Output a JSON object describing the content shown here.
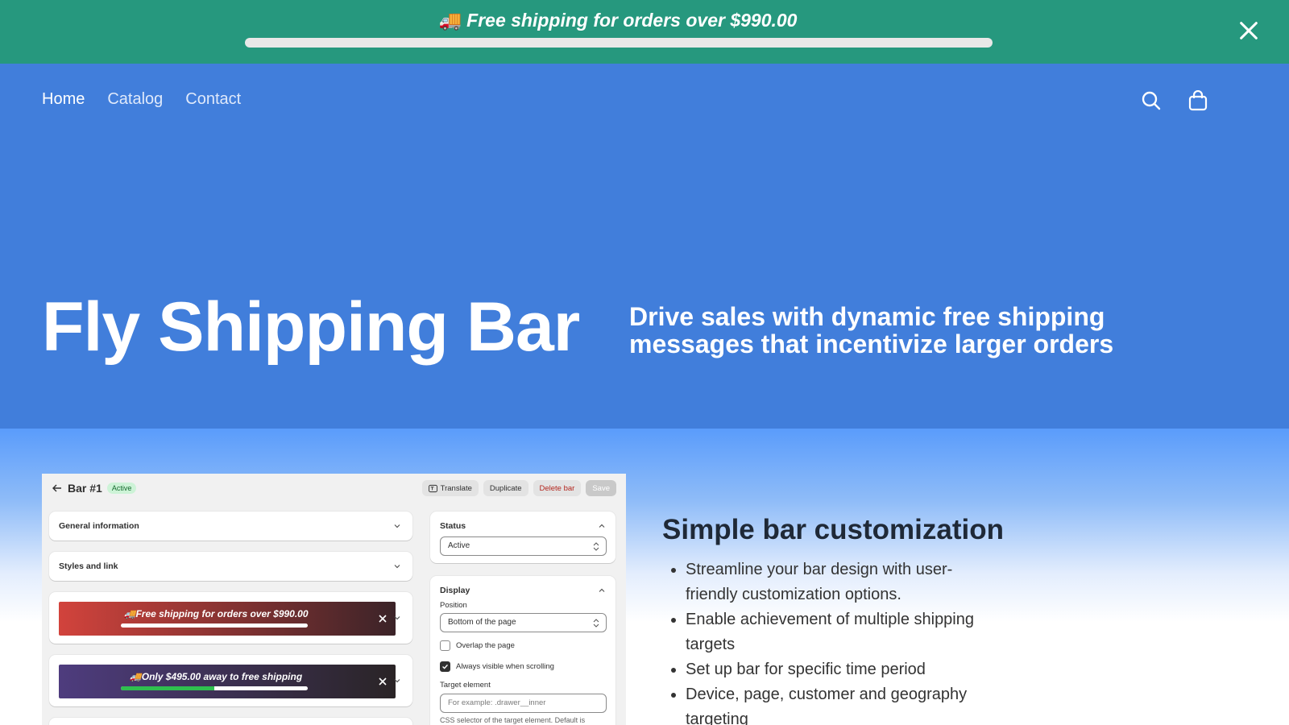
{
  "shipping_bar": {
    "emoji": "🚚",
    "message": "Free shipping for orders over $990.00",
    "progress": 0
  },
  "nav": {
    "items": [
      {
        "label": "Home",
        "active": true
      },
      {
        "label": "Catalog",
        "active": false
      },
      {
        "label": "Contact",
        "active": false
      }
    ]
  },
  "hero": {
    "title": "Fly Shipping Bar",
    "tagline": "Drive sales with dynamic free shipping messages that incentivize larger orders"
  },
  "admin": {
    "title": "Bar #1",
    "badge": "Active",
    "actions": {
      "translate": "Translate",
      "duplicate": "Duplicate",
      "delete": "Delete bar",
      "save": "Save"
    },
    "sections": {
      "general": "General information",
      "styles": "Styles and link"
    },
    "previews": [
      {
        "emoji": "🚚",
        "text": "Free shipping for orders over $990.00",
        "progress": 1.0,
        "fill_color": "#ffffff",
        "gradient": [
          "#d2433c",
          "#3b2328"
        ]
      },
      {
        "emoji": "🚚",
        "text": "Only $495.00 away to free shipping",
        "progress": 0.5,
        "fill_color": "#2fbf4f",
        "gradient": [
          "#4e3c7e",
          "#2a2426"
        ]
      }
    ],
    "status": {
      "label": "Status",
      "value": "Active"
    },
    "display": {
      "label": "Display",
      "position_label": "Position",
      "position_value": "Bottom of the page",
      "overlap_label": "Overlap the page",
      "overlap_checked": false,
      "always_visible_label": "Always visible when scrolling",
      "always_visible_checked": true,
      "target_label": "Target element",
      "target_placeholder": "For example: .drawer__inner",
      "target_help": "CSS selector of the target element. Default is"
    }
  },
  "features": {
    "title": "Simple bar customization",
    "items": [
      "Streamline your bar design with user-friendly customization options.",
      "Enable achievement of multiple shipping targets",
      "Set up bar for specific time period",
      "Device, page, customer and geography targeting"
    ]
  },
  "colors": {
    "announcement_bg": "#26987e",
    "hero_bg": "#417edb",
    "section_bg_top": "#5a9cfb"
  }
}
